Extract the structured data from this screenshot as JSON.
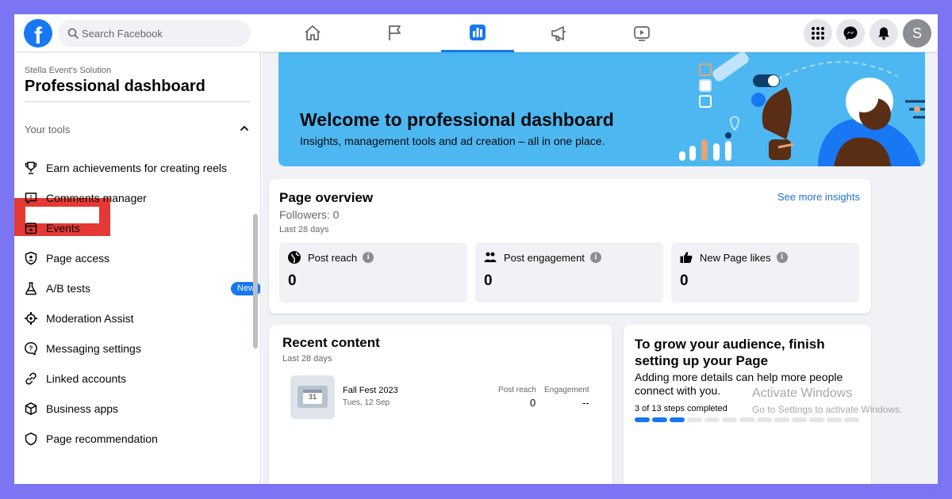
{
  "topbar": {
    "logo": "f",
    "search_placeholder": "Search Facebook",
    "avatar_initial": "S",
    "nav_tabs": [
      "home",
      "pages",
      "professional dashboard",
      "ads",
      "watch"
    ]
  },
  "sidebar": {
    "page_name": "Stella Event's Solution",
    "title": "Professional dashboard",
    "section_label": "Your tools",
    "items": [
      {
        "label": "Earn achievements for creating reels",
        "icon": "trophy-icon"
      },
      {
        "label": "Comments manager",
        "icon": "comment-icon"
      },
      {
        "label": "Events",
        "icon": "calendar-icon"
      },
      {
        "label": "Page access",
        "icon": "shield-icon"
      },
      {
        "label": "A/B tests",
        "icon": "flask-icon",
        "badge": "New"
      },
      {
        "label": "Moderation Assist",
        "icon": "gear-icon"
      },
      {
        "label": "Messaging settings",
        "icon": "message-settings-icon"
      },
      {
        "label": "Linked accounts",
        "icon": "link-icon"
      },
      {
        "label": "Business apps",
        "icon": "cube-icon"
      },
      {
        "label": "Page recommendation",
        "icon": "recommend-icon"
      }
    ]
  },
  "banner": {
    "title": "Welcome to professional dashboard",
    "subtitle": "Insights, management tools and ad creation – all in one place."
  },
  "overview": {
    "title": "Page overview",
    "link": "See more insights",
    "followers": "Followers: 0",
    "period": "Last 28 days",
    "metrics": [
      {
        "label": "Post reach",
        "value": "0",
        "icon": "globe-icon"
      },
      {
        "label": "Post engagement",
        "value": "0",
        "icon": "people-icon"
      },
      {
        "label": "New Page likes",
        "value": "0",
        "icon": "thumbs-up-icon"
      }
    ]
  },
  "recent": {
    "title": "Recent content",
    "period": "Last 28 days",
    "thumb_text": "31",
    "item": {
      "name": "Fall Fest 2023",
      "date": "Tues, 12 Sep",
      "reach_label": "Post reach",
      "engagement_label": "Engagement",
      "reach": "0",
      "engagement": "--"
    }
  },
  "grow": {
    "title": "To grow your audience, finish setting up your Page",
    "description": "Adding more details can help more people connect with you.",
    "steps": "3 of 13 steps completed",
    "steps_completed": 3,
    "steps_total": 13
  },
  "watermark": {
    "line1": "Activate Windows",
    "line2": "Go to Settings to activate Windows."
  },
  "colors": {
    "brand": "#1877f2",
    "highlight": "#e53935",
    "banner": "#4db7f2",
    "outer_frame": "#7b74f3"
  }
}
